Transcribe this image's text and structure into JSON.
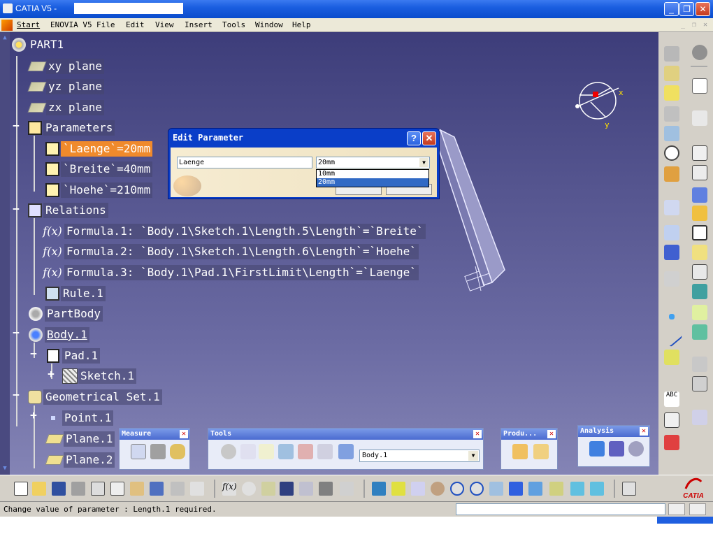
{
  "window": {
    "title": "CATIA V5 -",
    "minimize": "_",
    "maximize": "❐",
    "close": "✕"
  },
  "menu": [
    "Start",
    "ENOVIA V5",
    "File",
    "Edit",
    "View",
    "Insert",
    "Tools",
    "Window",
    "Help"
  ],
  "tree": {
    "root": "PART1",
    "xy": "xy plane",
    "yz": "yz plane",
    "zx": "zx plane",
    "parameters": "Parameters",
    "p1": "`Laenge`=20mm",
    "p2": "`Breite`=40mm",
    "p3": "`Hoehe`=210mm",
    "relations": "Relations",
    "f1": "Formula.1: `Body.1\\Sketch.1\\Length.5\\Length`=`Breite`",
    "f2": "Formula.2: `Body.1\\Sketch.1\\Length.6\\Length`=`Hoehe`",
    "f3": "Formula.3: `Body.1\\Pad.1\\FirstLimit\\Length`=`Laenge`",
    "rule": "Rule.1",
    "partbody": "PartBody",
    "body": "Body.1",
    "pad": "Pad.1",
    "sketch": "Sketch.1",
    "geoset": "Geometrical Set.1",
    "point": "Point.1",
    "plane1": "Plane.1",
    "plane2": "Plane.2"
  },
  "dialog": {
    "title": "Edit Parameter",
    "help": "?",
    "close": "✕",
    "name_value": "Laenge",
    "value_selected": "20mm",
    "options": [
      "10mm",
      "20mm"
    ]
  },
  "compass": {
    "x": "x",
    "y": "y"
  },
  "panels": {
    "measure": "Measure",
    "tools": "Tools",
    "tools_body": "Body.1",
    "product": "Produ...",
    "analysis": "Analysis",
    "close": "✕"
  },
  "status": {
    "message": "Change value of parameter : Length.1 required.",
    "command_value": ""
  },
  "logo": "CATIA",
  "colors": {
    "selected": "#f08a2c",
    "titlebar": "#1a5ee0",
    "canvas_top": "#3d3d7a",
    "canvas_bottom": "#8484b5"
  }
}
